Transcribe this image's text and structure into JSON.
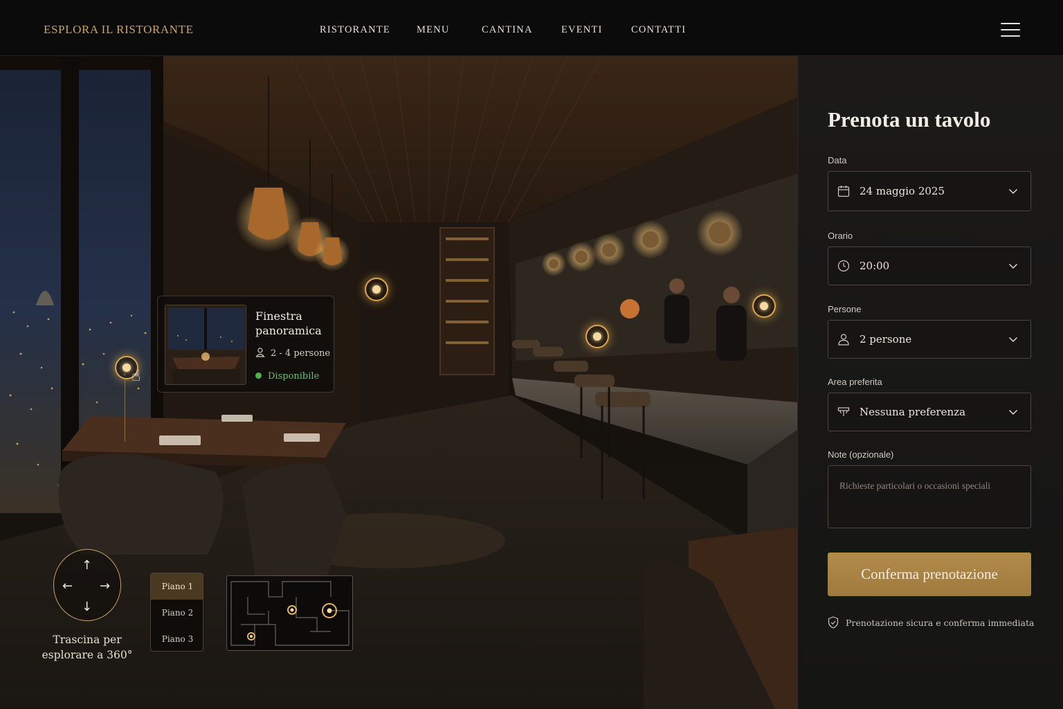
{
  "nav": {
    "brand": "ESPLORA IL RISTORANTE",
    "links": [
      "RISTORANTE",
      "MENU",
      "CANTINA",
      "EVENTI",
      "CONTATTI"
    ],
    "menu_icon": "hamburger-icon"
  },
  "tour": {
    "popup": {
      "title": "Finestra panoramica",
      "people": "2 - 4 persone",
      "status": "Disponibile"
    },
    "drag_hint": "Trascina per esplorare a 360°",
    "floors": [
      "Piano 1",
      "Piano 2",
      "Piano 3"
    ],
    "active_floor": "Piano 1"
  },
  "booking": {
    "title": "Prenota un tavolo",
    "date_label": "Data",
    "date_value": "24 maggio 2025",
    "time_label": "Orario",
    "time_value": "20:00",
    "people_label": "Persone",
    "people_value": "2 persone",
    "area_label": "Area preferita",
    "area_value": "Nessuna preferenza",
    "notes_label": "Note (opzionale)",
    "notes_placeholder": "Richieste particolari o occasioni speciali",
    "confirm_label": "Conferma prenotazione",
    "secure_note": "Prenotazione sicura e conferma immediata"
  },
  "colors": {
    "accent_gold": "#c9a46a",
    "button_gold": "#a98243",
    "available_green": "#4bb54a"
  }
}
